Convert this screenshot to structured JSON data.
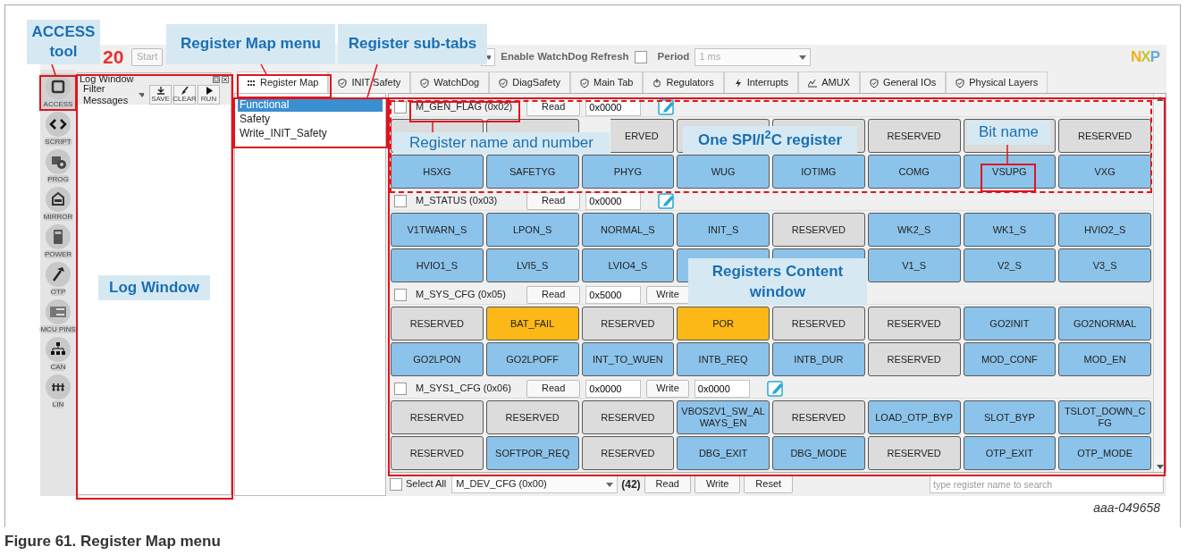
{
  "app_bar": {
    "title": "20",
    "start_button": "Start",
    "watchdog_label": "Enable WatchDog Refresh",
    "watchdog_checked": false,
    "period_label": "Period",
    "period_value": "1 ms",
    "logo": "NXP"
  },
  "tool_sidebar": [
    {
      "label": "ACCESS",
      "selected": true
    },
    {
      "label": "SCRIPT",
      "selected": false
    },
    {
      "label": "PROG",
      "selected": false
    },
    {
      "label": "MIRROR",
      "selected": false
    },
    {
      "label": "POWER",
      "selected": false
    },
    {
      "label": "OTP",
      "selected": false
    },
    {
      "label": "MCU PINS",
      "selected": false
    },
    {
      "label": "CAN",
      "selected": false
    },
    {
      "label": "LIN",
      "selected": false
    }
  ],
  "log_window": {
    "title": "Log Window",
    "filter": "Filter Messages",
    "buttons": [
      "SAVE",
      "CLEAR",
      "RUN"
    ]
  },
  "tabs": [
    {
      "label": "Register Map",
      "selected": true
    },
    {
      "label": "INIT Safety",
      "selected": false
    },
    {
      "label": "WatchDog",
      "selected": false
    },
    {
      "label": "DiagSafety",
      "selected": false
    },
    {
      "label": "Main Tab",
      "selected": false
    },
    {
      "label": "Regulators",
      "selected": false
    },
    {
      "label": "Interrupts",
      "selected": false
    },
    {
      "label": "AMUX",
      "selected": false
    },
    {
      "label": "General IOs",
      "selected": false
    },
    {
      "label": "Physical Layers",
      "selected": false
    }
  ],
  "sub_tabs": [
    {
      "label": "Functional",
      "selected": true
    },
    {
      "label": "Safety",
      "selected": false
    },
    {
      "label": "Write_INIT_Safety",
      "selected": false
    }
  ],
  "registers": [
    {
      "name": "M_GEN_FLAG (0x02)",
      "checked": false,
      "read_button": "Read",
      "value": "0x0000",
      "edit": true,
      "bits": [
        {
          "color": "#dcdcdc"
        },
        {
          "color": "#dcdcdc"
        },
        {
          "label": "ERVED",
          "color": "#dcdcdc",
          "kind": "partial"
        },
        {
          "color": "#dcdcdc"
        },
        {
          "color": "#dcdcdc"
        },
        {
          "label": "RESERVED",
          "color": "#dcdcdc"
        },
        {
          "color": "#dcdcdc"
        },
        {
          "label": "RESERVED",
          "color": "#dcdcdc"
        },
        {
          "label": "HSXG",
          "color": "#8cc3ea"
        },
        {
          "label": "SAFETYG",
          "color": "#8cc3ea"
        },
        {
          "label": "PHYG",
          "color": "#8cc3ea"
        },
        {
          "label": "WUG",
          "color": "#8cc3ea"
        },
        {
          "label": "IOTIMG",
          "color": "#8cc3ea"
        },
        {
          "label": "COMG",
          "color": "#8cc3ea"
        },
        {
          "label": "VSUPG",
          "color": "#8cc3ea"
        },
        {
          "label": "VXG",
          "color": "#8cc3ea"
        }
      ]
    },
    {
      "name": "M_STATUS (0x03)",
      "checked": false,
      "read_button": "Read",
      "value": "0x0000",
      "edit": true,
      "bits": [
        {
          "label": "V1TWARN_S",
          "color": "#8cc3ea"
        },
        {
          "label": "LPON_S",
          "color": "#8cc3ea"
        },
        {
          "label": "NORMAL_S",
          "color": "#8cc3ea"
        },
        {
          "label": "INIT_S",
          "color": "#8cc3ea"
        },
        {
          "label": "RESERVED",
          "color": "#dcdcdc"
        },
        {
          "label": "WK2_S",
          "color": "#8cc3ea"
        },
        {
          "label": "WK1_S",
          "color": "#8cc3ea"
        },
        {
          "label": "HVIO2_S",
          "color": "#8cc3ea"
        },
        {
          "label": "HVIO1_S",
          "color": "#8cc3ea"
        },
        {
          "label": "LVI5_S",
          "color": "#8cc3ea"
        },
        {
          "label": "LVIO4_S",
          "color": "#8cc3ea"
        },
        {
          "color": "#8cc3ea"
        },
        {
          "color": "#8cc3ea"
        },
        {
          "label": "V1_S",
          "color": "#8cc3ea"
        },
        {
          "label": "V2_S",
          "color": "#8cc3ea"
        },
        {
          "label": "V3_S",
          "color": "#8cc3ea"
        }
      ]
    },
    {
      "name": "M_SYS_CFG (0x05)",
      "checked": false,
      "read_button": "Read",
      "value": "0x5000",
      "write_button": "Write",
      "edit": false,
      "bits": [
        {
          "label": "RESERVED",
          "color": "#dcdcdc"
        },
        {
          "label": "BAT_FAIL",
          "color": "#fbb817"
        },
        {
          "label": "RESERVED",
          "color": "#dcdcdc"
        },
        {
          "label": "POR",
          "color": "#fbb817"
        },
        {
          "label": "RESERVED",
          "color": "#dcdcdc"
        },
        {
          "label": "RESERVED",
          "color": "#dcdcdc"
        },
        {
          "label": "GO2INIT",
          "color": "#8cc3ea"
        },
        {
          "label": "GO2NORMAL",
          "color": "#8cc3ea"
        },
        {
          "label": "GO2LPON",
          "color": "#8cc3ea"
        },
        {
          "label": "GO2LPOFF",
          "color": "#8cc3ea"
        },
        {
          "label": "INT_TO_WUEN",
          "color": "#8cc3ea"
        },
        {
          "label": "INTB_REQ",
          "color": "#8cc3ea"
        },
        {
          "label": "INTB_DUR",
          "color": "#8cc3ea"
        },
        {
          "label": "RESERVED",
          "color": "#dcdcdc"
        },
        {
          "label": "MOD_CONF",
          "color": "#8cc3ea"
        },
        {
          "label": "MOD_EN",
          "color": "#8cc3ea"
        }
      ]
    },
    {
      "name": "M_SYS1_CFG (0x06)",
      "checked": false,
      "read_button": "Read",
      "value": "0x0000",
      "write_button": "Write",
      "write_value": "0x0000",
      "edit": true,
      "bits": [
        {
          "label": "RESERVED",
          "color": "#dcdcdc"
        },
        {
          "label": "RESERVED",
          "color": "#dcdcdc"
        },
        {
          "label": "RESERVED",
          "color": "#dcdcdc"
        },
        {
          "label": "VBOS2V1_SW_ALWAYS_EN",
          "color": "#8cc3ea"
        },
        {
          "label": "RESERVED",
          "color": "#dcdcdc"
        },
        {
          "label": "LOAD_OTP_BYP",
          "color": "#8cc3ea"
        },
        {
          "label": "SLOT_BYP",
          "color": "#8cc3ea"
        },
        {
          "label": "TSLOT_DOWN_CFG",
          "color": "#8cc3ea"
        },
        {
          "label": "RESERVED",
          "color": "#dcdcdc"
        },
        {
          "label": "SOFTPOR_REQ",
          "color": "#8cc3ea"
        },
        {
          "label": "RESERVED",
          "color": "#dcdcdc"
        },
        {
          "label": "DBG_EXIT",
          "color": "#8cc3ea"
        },
        {
          "label": "DBG_MODE",
          "color": "#8cc3ea"
        },
        {
          "label": "RESERVED",
          "color": "#dcdcdc"
        },
        {
          "label": "OTP_EXIT",
          "color": "#8cc3ea"
        },
        {
          "label": "OTP_MODE",
          "color": "#8cc3ea"
        }
      ]
    }
  ],
  "bottom_bar": {
    "select_all": "Select All",
    "select_all_checked": false,
    "register": "M_DEV_CFG (0x00)",
    "count": "(42)",
    "buttons": [
      "Read",
      "Write",
      "Reset"
    ],
    "search_placeholder": "type register name to search"
  },
  "annotations": [
    {
      "text": "ACCESS tool",
      "bold": true
    },
    {
      "text": "Register Map menu",
      "bold": true
    },
    {
      "text": "Register sub-tabs",
      "bold": true
    },
    {
      "text": "Register name and number",
      "bold": false
    },
    {
      "text": "One SPI/I$^{2}$C register",
      "bold": true
    },
    {
      "text": "Bit name",
      "bold": false
    },
    {
      "text": "Log Window",
      "bold": true
    },
    {
      "text": "Registers Content window",
      "bold": true
    }
  ],
  "figure_id": "aaa-049658",
  "caption": "Figure 61.  Register Map menu"
}
